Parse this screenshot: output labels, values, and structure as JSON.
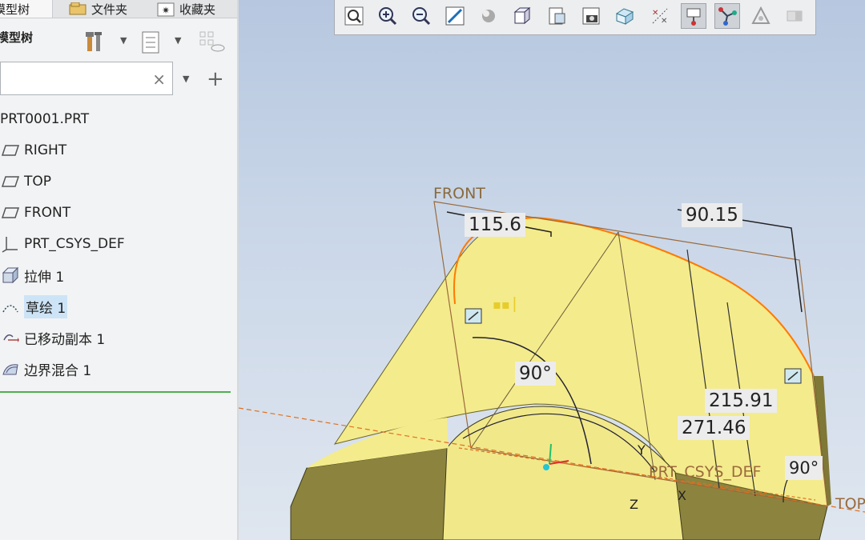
{
  "panel": {
    "tabs": [
      {
        "label": "模型树",
        "icon": "model-tree-icon"
      },
      {
        "label": "文件夹",
        "icon": "folder-icon"
      },
      {
        "label": "收藏夹",
        "icon": "favorites-icon"
      }
    ],
    "header": "模型树",
    "search": {
      "value": "",
      "placeholder": ""
    },
    "tree": [
      {
        "label": "PRT0001.PRT",
        "icon": "part-icon"
      },
      {
        "label": "RIGHT",
        "icon": "datum-plane-icon"
      },
      {
        "label": "TOP",
        "icon": "datum-plane-icon"
      },
      {
        "label": "FRONT",
        "icon": "datum-plane-icon"
      },
      {
        "label": "PRT_CSYS_DEF",
        "icon": "coordinate-system-icon"
      },
      {
        "label": "拉伸 1",
        "icon": "extrude-icon"
      },
      {
        "label": "草绘 1",
        "icon": "sketch-icon",
        "selected": true
      },
      {
        "label": "已移动副本 1",
        "icon": "moved-copy-icon"
      },
      {
        "label": "边界混合 1",
        "icon": "boundary-blend-icon"
      }
    ]
  },
  "toolbar": [
    {
      "name": "refit-icon"
    },
    {
      "name": "zoom-in-icon"
    },
    {
      "name": "zoom-out-icon"
    },
    {
      "name": "repaint-icon"
    },
    {
      "name": "display-style-icon"
    },
    {
      "name": "saved-orientations-icon"
    },
    {
      "name": "view-manager-icon"
    },
    {
      "name": "perspective-icon"
    },
    {
      "name": "section-icon"
    },
    {
      "name": "datum-display-icon"
    },
    {
      "name": "annotation-display-icon",
      "active": true
    },
    {
      "name": "spin-center-icon",
      "active": true
    },
    {
      "name": "appearance-icon"
    },
    {
      "name": "sketch-view-icon"
    }
  ],
  "viewport": {
    "plane_labels": {
      "front": "FRONT",
      "top": "TOP",
      "csys": "PRT_CSYS_DEF"
    },
    "axis_labels": {
      "x": "X",
      "y": "Y",
      "z": "Z"
    },
    "dimensions": {
      "d1": "115.6",
      "d2": "90.15",
      "d3": "90°",
      "d4": "215.91",
      "d5": "271.46",
      "d6": "90°"
    },
    "colors": {
      "surface": "#f4eb8c",
      "dark_face": "#8c843e",
      "sketch_curve": "#ff7700",
      "plane_edge": "#9b6a3c"
    }
  }
}
